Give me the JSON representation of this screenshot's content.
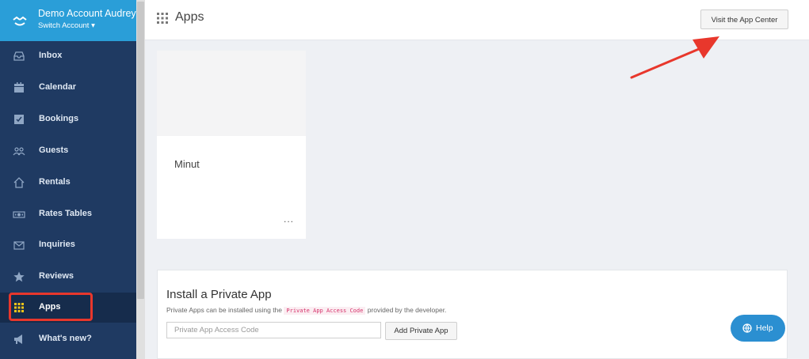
{
  "account": {
    "name": "Demo Account Audrey",
    "switch_label": "Switch Account"
  },
  "sidebar": {
    "items": [
      {
        "label": "Inbox",
        "icon": "inbox-icon"
      },
      {
        "label": "Calendar",
        "icon": "calendar-icon"
      },
      {
        "label": "Bookings",
        "icon": "bookings-icon"
      },
      {
        "label": "Guests",
        "icon": "guests-icon"
      },
      {
        "label": "Rentals",
        "icon": "home-icon"
      },
      {
        "label": "Rates Tables",
        "icon": "rates-icon"
      },
      {
        "label": "Inquiries",
        "icon": "envelope-icon"
      },
      {
        "label": "Reviews",
        "icon": "star-icon"
      },
      {
        "label": "Apps",
        "icon": "grid-icon",
        "active": true
      },
      {
        "label": "What's new?",
        "icon": "megaphone-icon"
      }
    ]
  },
  "header": {
    "title": "Apps",
    "visit_button": "Visit the App Center"
  },
  "apps": [
    {
      "name": "Minut",
      "menu_label": "..."
    }
  ],
  "private_app": {
    "heading": "Install a Private App",
    "desc_before": "Private Apps can be installed using the",
    "desc_code": "Private App Access Code",
    "desc_after": "provided by the developer.",
    "input_placeholder": "Private App Access Code",
    "add_button": "Add Private App"
  },
  "help": {
    "label": "Help"
  },
  "colors": {
    "sidebar_bg": "#1f3a62",
    "account_bg": "#2a9ed8",
    "highlight": "#e8372c",
    "help_bg": "#2b8fd1"
  }
}
